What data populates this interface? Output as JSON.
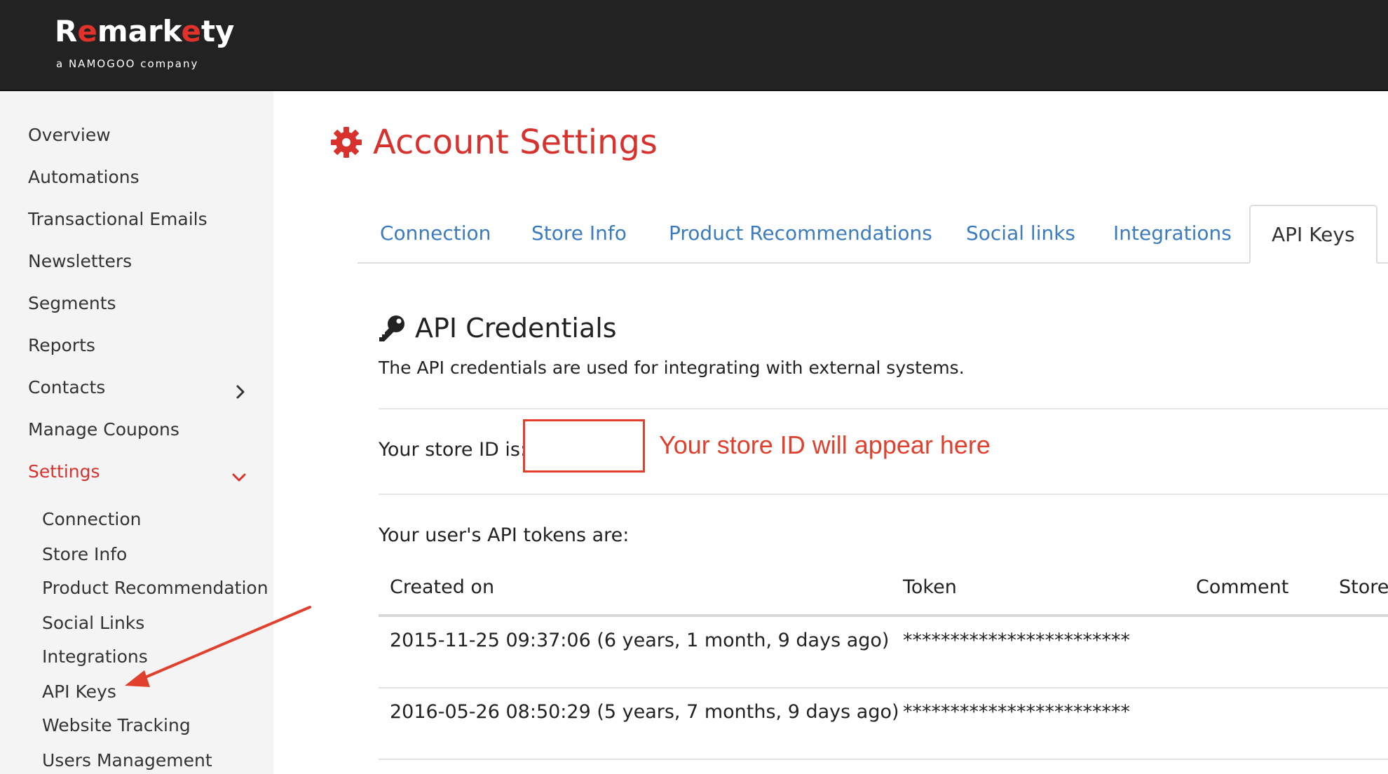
{
  "brand": {
    "name_pre": "R",
    "name_e1": "e",
    "name_mid": "mark",
    "name_e2": "e",
    "name_post": "ty",
    "tagline": "a NAMOGOO company",
    "accent": "#d8322e"
  },
  "sidebar": {
    "items": [
      {
        "label": "Overview"
      },
      {
        "label": "Automations"
      },
      {
        "label": "Transactional Emails"
      },
      {
        "label": "Newsletters"
      },
      {
        "label": "Segments"
      },
      {
        "label": "Reports"
      },
      {
        "label": "Contacts"
      },
      {
        "label": "Manage Coupons"
      },
      {
        "label": "Settings"
      }
    ],
    "settings_sub": [
      {
        "label": "Connection"
      },
      {
        "label": "Store Info"
      },
      {
        "label": "Product Recommendation"
      },
      {
        "label": "Social Links"
      },
      {
        "label": "Integrations"
      },
      {
        "label": "API Keys"
      },
      {
        "label": "Website Tracking"
      },
      {
        "label": "Users Management"
      }
    ]
  },
  "header": {
    "title": "Account Settings",
    "icon": "gear-icon"
  },
  "tabs": [
    {
      "label": "Connection"
    },
    {
      "label": "Store Info"
    },
    {
      "label": "Product Recommendations"
    },
    {
      "label": "Social links"
    },
    {
      "label": "Integrations"
    },
    {
      "label": "API Keys",
      "active": true
    }
  ],
  "credentials": {
    "title": "API Credentials",
    "icon": "key-icon",
    "description": "The API credentials are used for integrating with external systems.",
    "store_id_label": "Your store ID is:",
    "store_id_value": "",
    "store_id_note": "Your store ID will appear here",
    "tokens_label": "Your user's API tokens are:"
  },
  "table": {
    "columns": [
      "Created on",
      "Token",
      "Comment",
      "Store"
    ],
    "rows": [
      {
        "created": "2015-11-25 09:37:06 (6 years, 1 month, 9 days ago)",
        "token": "************************",
        "comment": "",
        "store": ""
      },
      {
        "created": "2016-05-26 08:50:29 (5 years, 7 months, 9 days ago)",
        "token": "************************",
        "comment": "",
        "store": ""
      }
    ]
  },
  "annotation_color": "#e0402d"
}
